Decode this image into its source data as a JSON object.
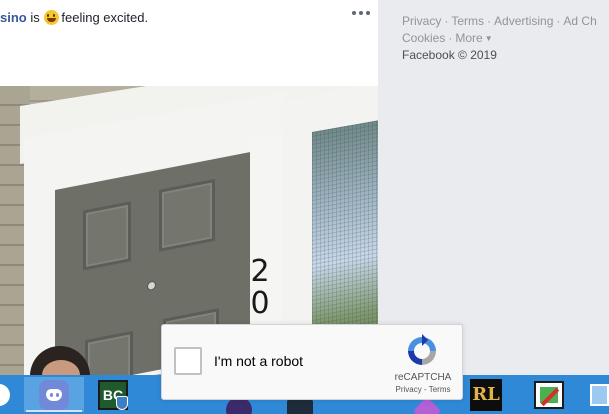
{
  "post": {
    "author_partial": "sino",
    "connector": "is",
    "emoji": "grinning-face-icon",
    "activity": "feeling excited."
  },
  "footer": {
    "links": [
      "Privacy",
      "Terms",
      "Advertising",
      "Ad Ch",
      "Cookies",
      "More"
    ],
    "separator": "·",
    "copyright": "Facebook © 2019"
  },
  "photo": {
    "house_number": "20"
  },
  "recaptcha": {
    "label": "I'm not a robot",
    "brand": "reCAPTCHA",
    "privacy": "Privacy",
    "dash": "-",
    "terms": "Terms",
    "checked": false
  },
  "taskbar": {
    "apps": [
      "start-button",
      "discord-icon",
      "bc-antivirus-icon",
      "round-app-icon",
      "square-app-icon",
      "purple-app-icon",
      "rl-app-icon",
      "edit-app-icon",
      "monitor-icon"
    ],
    "bc_label": "BC",
    "rl_label": "RL",
    "colors": {
      "bar": "#2f89d6",
      "active": "#5aa3e3"
    }
  }
}
